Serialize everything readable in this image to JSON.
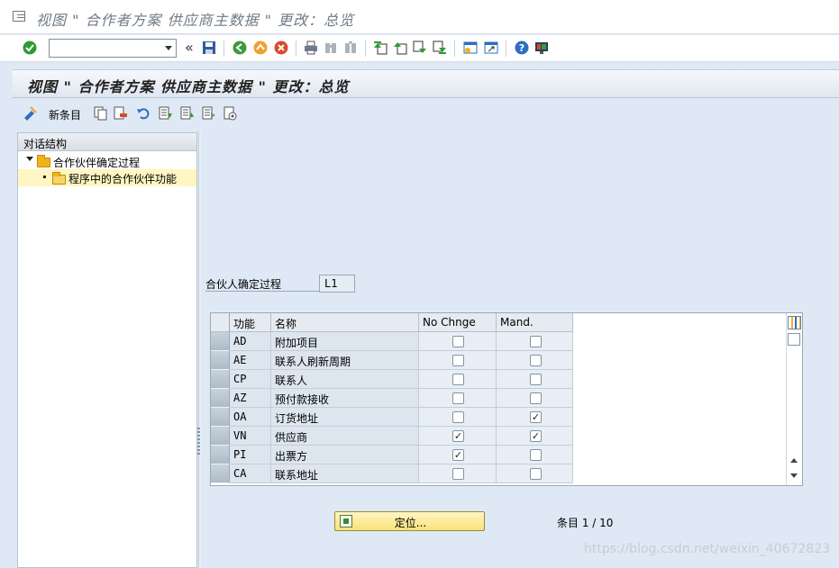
{
  "window": {
    "title": "视图 \" 合作者方案 供应商主数据 \" 更改：总览"
  },
  "toolbar": {
    "command_value": "",
    "icons": [
      "enter-icon",
      "save-icon",
      "back-icon",
      "exit-icon",
      "cancel-icon",
      "print-icon",
      "find-icon",
      "find-next-icon",
      "first-page-icon",
      "previous-page-icon",
      "next-page-icon",
      "last-page-icon",
      "create-session-icon",
      "shortcut-icon",
      "help-icon",
      "layout-icon"
    ]
  },
  "screen": {
    "title": "视图 \" 合作者方案 供应商主数据 \" 更改：总览",
    "new_entries_label": "新条目"
  },
  "tree": {
    "header": "对话结构",
    "root_label": "合作伙伴确定过程",
    "child_label": "程序中的合作伙伴功能"
  },
  "field": {
    "label": "合伙人确定过程",
    "value": "L1"
  },
  "table": {
    "headers": [
      "功能",
      "名称",
      "No Chnge",
      "Mand."
    ],
    "rows": [
      {
        "code": "AD",
        "name": "附加项目",
        "no_change": false,
        "mandatory": false
      },
      {
        "code": "AE",
        "name": "联系人刷新周期",
        "no_change": false,
        "mandatory": false
      },
      {
        "code": "CP",
        "name": "联系人",
        "no_change": false,
        "mandatory": false
      },
      {
        "code": "AZ",
        "name": "预付款接收",
        "no_change": false,
        "mandatory": false
      },
      {
        "code": "OA",
        "name": "订货地址",
        "no_change": false,
        "mandatory": true
      },
      {
        "code": "VN",
        "name": "供应商",
        "no_change": true,
        "mandatory": true
      },
      {
        "code": "PI",
        "name": "出票方",
        "no_change": true,
        "mandatory": false
      },
      {
        "code": "CA",
        "name": "联系地址",
        "no_change": false,
        "mandatory": false
      }
    ]
  },
  "footer": {
    "position_label": "定位...",
    "entry_count": "条目 1 / 10",
    "watermark": "https://blog.csdn.net/weixin_40672823"
  },
  "colors": {
    "background": "#dfe9f5",
    "button_yellow": "#f9e27a",
    "enter_green": "#2e9b34",
    "back_green": "#3b9a3b",
    "exit_orange": "#f0a030",
    "cancel_red": "#d84a2a",
    "help_blue": "#2b6fc0"
  }
}
